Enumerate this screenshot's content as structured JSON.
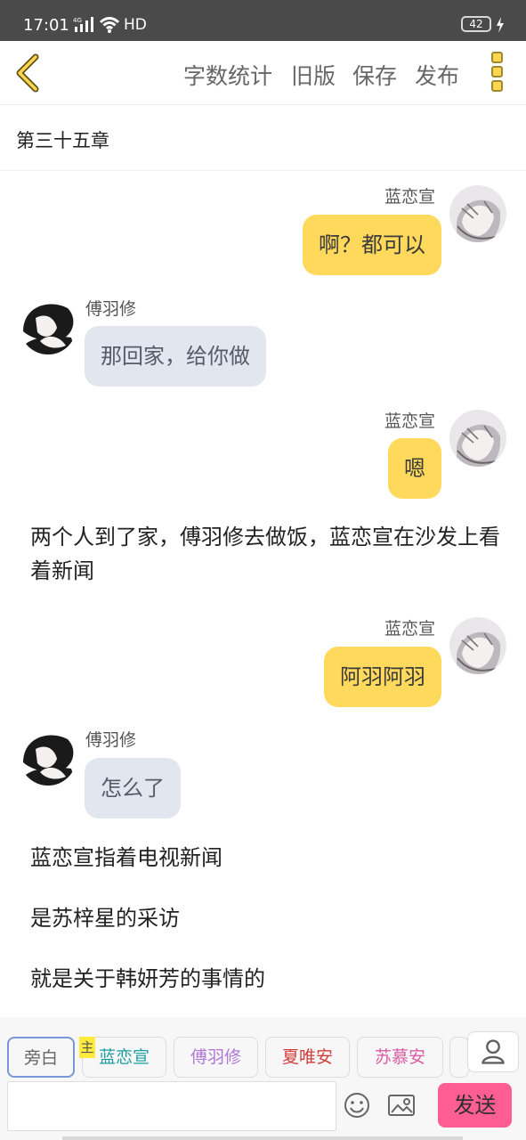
{
  "status": {
    "time": "17:01",
    "network": "4G",
    "hd_label": "HD",
    "battery": "42",
    "signal_icon": "signal-icon",
    "wifi_icon": "wifi-icon",
    "charge_icon": "charging-icon"
  },
  "toolbar": {
    "back_icon": "chevron-left-icon",
    "actions": [
      "字数统计",
      "旧版",
      "保存",
      "发布"
    ],
    "more_icon": "more-icon"
  },
  "chapter": {
    "title": "第三十五章"
  },
  "messages": [
    {
      "speaker": "蓝恋宣",
      "text": "啊？都可以",
      "side": "right"
    },
    {
      "speaker": "傅羽修",
      "text": "那回家，给你做",
      "side": "left"
    },
    {
      "speaker": "蓝恋宣",
      "text": "嗯",
      "side": "right"
    },
    {
      "narration": "两个人到了家，傅羽修去做饭，蓝恋宣在沙发上看着新闻"
    },
    {
      "speaker": "蓝恋宣",
      "text": "阿羽阿羽",
      "side": "right"
    },
    {
      "speaker": "傅羽修",
      "text": "怎么了",
      "side": "left"
    },
    {
      "narration": "蓝恋宣指着电视新闻"
    },
    {
      "narration": "是苏梓星的采访"
    },
    {
      "narration": "就是关于韩妍芳的事情的"
    }
  ],
  "composer": {
    "roles": [
      {
        "label": "旁白",
        "color": "#666666",
        "selected": true
      },
      {
        "label": "蓝恋宣",
        "color": "#1e9e9f",
        "main_mark": "主"
      },
      {
        "label": "傅羽修",
        "color": "#b178d8"
      },
      {
        "label": "夏唯安",
        "color": "#d33b3b"
      },
      {
        "label": "苏慕安",
        "color": "#d85da4"
      }
    ],
    "input_value": "",
    "input_placeholder": "",
    "emoji_icon": "emoji-icon",
    "image_icon": "image-icon",
    "send_label": "发送",
    "role_add_icon": "person-icon"
  },
  "colors": {
    "status_bar": "#4a4a4a",
    "my_bubble": "#ffd95c",
    "other_bubble": "#e2e6ee",
    "send_button": "#ff5e94",
    "accent_yellow": "#ffd54f"
  }
}
